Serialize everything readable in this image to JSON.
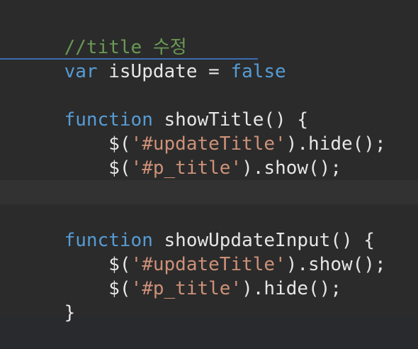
{
  "editor": {
    "lines": [
      {
        "comment": "//title 수정"
      },
      {
        "kw": "var",
        "ident": " isUpdate = ",
        "val": "false"
      },
      {},
      {
        "kw": "function",
        "ident": " showTitle() {"
      },
      {
        "indent": "    ",
        "pre": "$(",
        "str": "'#updateTitle'",
        "post": ").hide();"
      },
      {
        "indent": "    ",
        "pre": "$(",
        "str": "'#p_title'",
        "post": ").show();"
      },
      {
        "ident": "}"
      },
      {},
      {
        "kw": "function",
        "ident": " showUpdateInput() {"
      },
      {
        "indent": "    ",
        "pre": "$(",
        "str": "'#updateTitle'",
        "post": ").show();"
      },
      {
        "indent": "    ",
        "pre": "$(",
        "str": "'#p_title'",
        "post": ").hide();"
      },
      {
        "ident": "}"
      }
    ]
  }
}
